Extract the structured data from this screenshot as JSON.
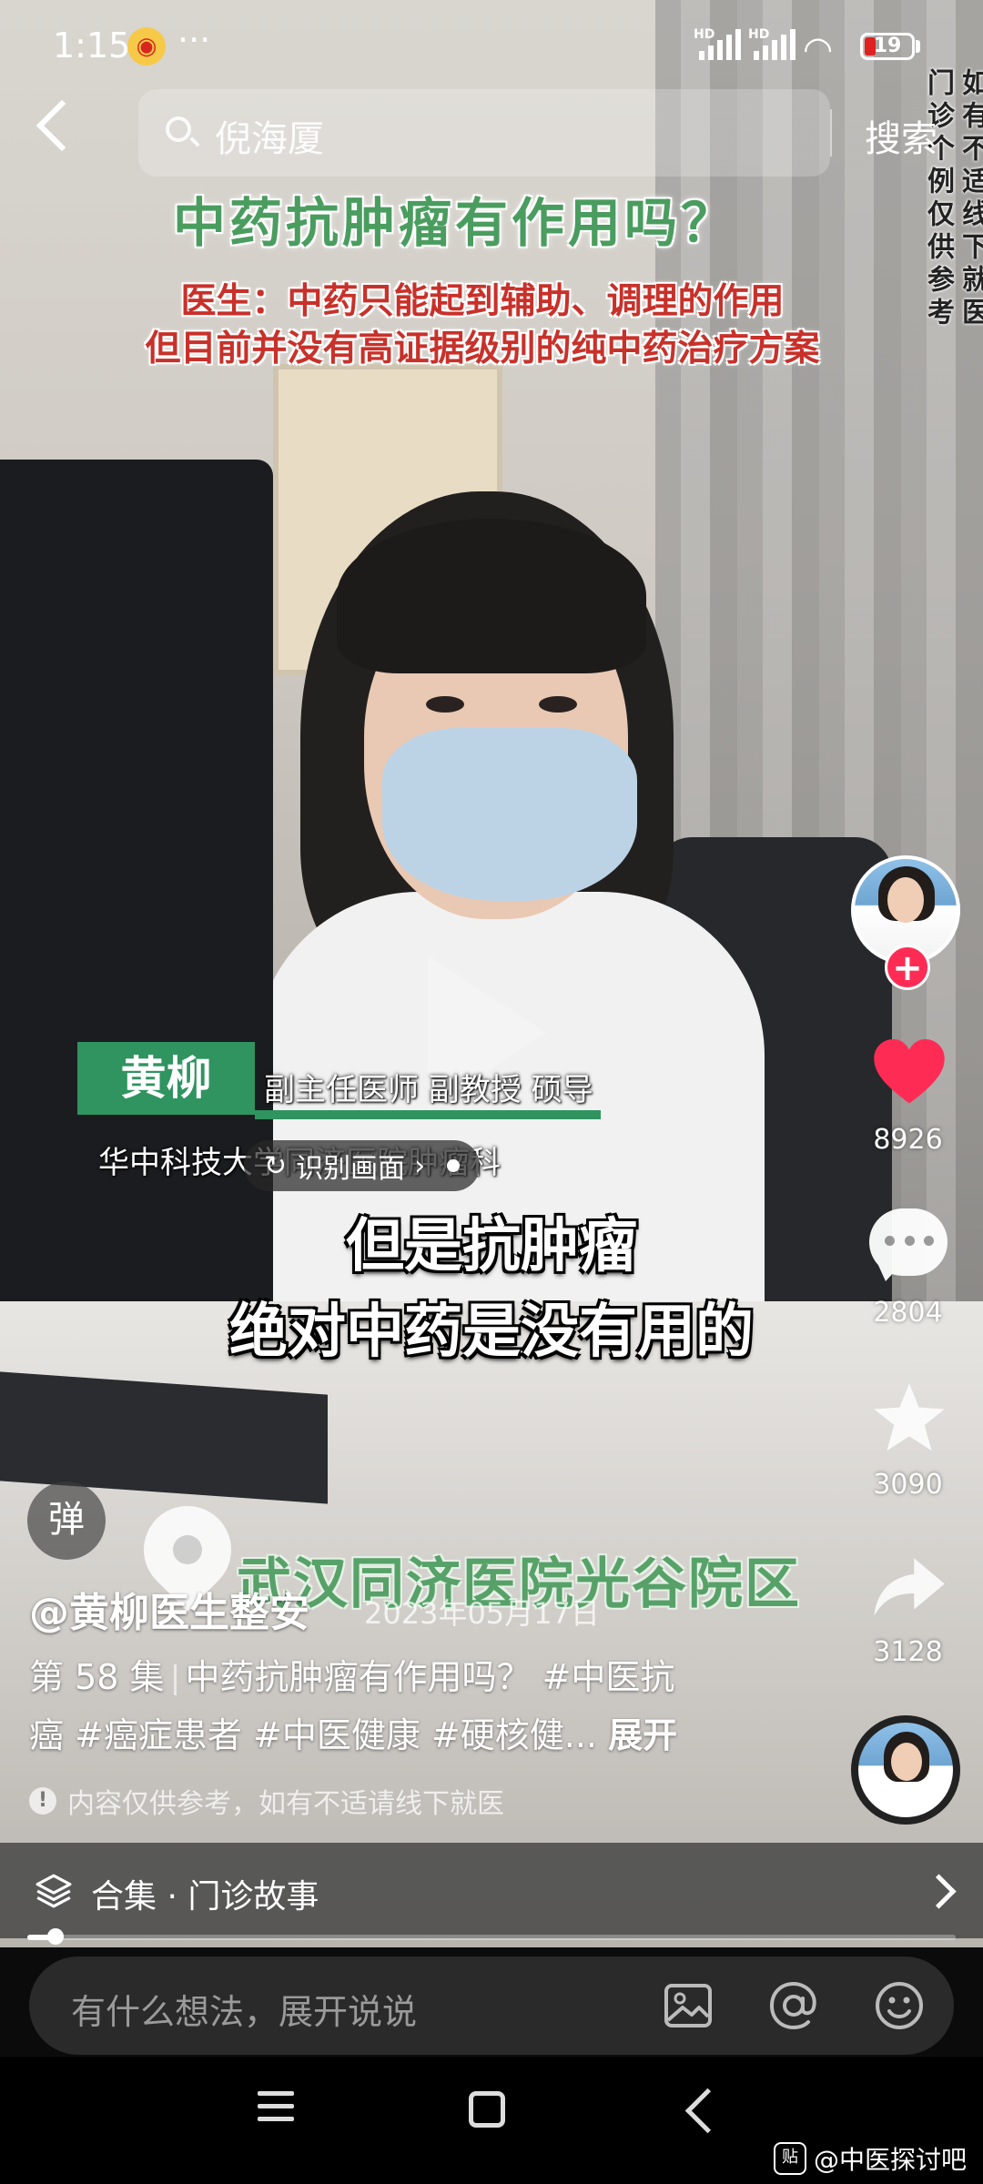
{
  "status_bar": {
    "time": "1:15",
    "more": "···",
    "network_1": "HD",
    "network_2": "HD",
    "battery": "19"
  },
  "search": {
    "query": "倪海厦",
    "button": "搜索"
  },
  "video_overlay": {
    "title": "中药抗肿瘤有作用吗？",
    "subtitle_line1": "医生：中药只能起到辅助、调理的作用",
    "subtitle_line2": "但目前并没有高证据级别的纯中药治疗方案",
    "side_notice_1": "门诊个例仅供参考",
    "side_notice_2": "如有不适线下就医",
    "doctor_name": "黄柳",
    "doctor_role": "副主任医师 副教授 硕导",
    "doctor_hospital": "华中科技大学同济医院肿瘤科",
    "recognize_label": "识别画面",
    "caption_line1": "但是抗肿瘤",
    "caption_line2": "绝对中药是没有用的",
    "location_text": "武汉同济医院光谷院区"
  },
  "actions": {
    "follow": "+",
    "likes": "8926",
    "comments": "2804",
    "favorites": "3090",
    "shares": "3128",
    "like_color": "#fe2c55"
  },
  "post": {
    "danmu_label": "弹",
    "author": "@黄柳医生整安",
    "date": "2023年05月17日",
    "desc_line1_episode": "第 58 集",
    "desc_line1_rest": "中药抗肿瘤有作用吗？ #中医抗",
    "desc_line2": "癌 #癌症患者 #中医健康 #硬核健...",
    "expand": "展开",
    "notice": "内容仅供参考，如有不适请线下就医",
    "notice_icon": "!"
  },
  "collection": {
    "label": "合集 · 门诊故事",
    "progress": 0.03
  },
  "comment_bar": {
    "placeholder": "有什么想法，展开说说"
  },
  "watermark": {
    "icon": "贴",
    "text": "@中医探讨吧"
  }
}
